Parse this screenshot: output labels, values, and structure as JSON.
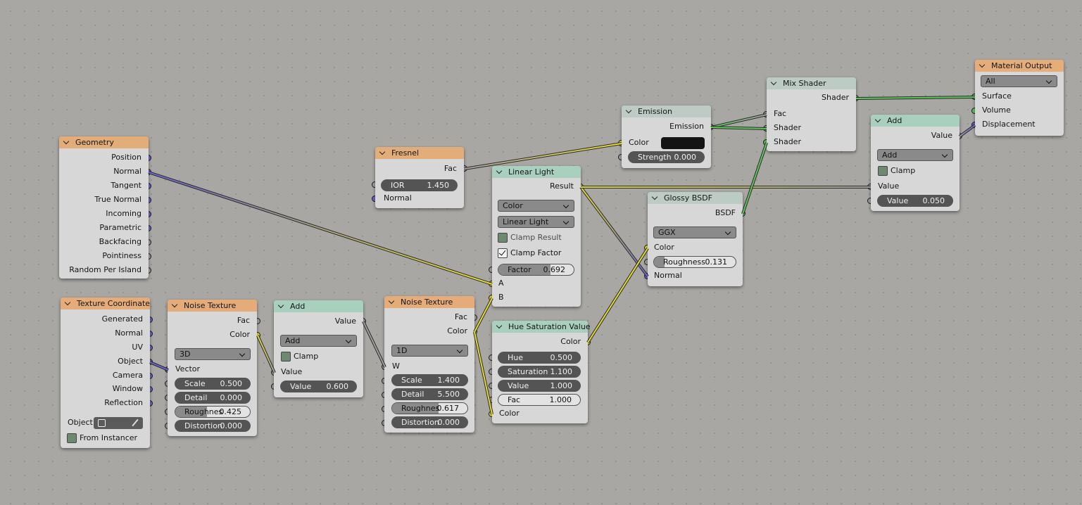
{
  "nodes": {
    "geometry": {
      "title": "Geometry",
      "outputs": [
        "Position",
        "Normal",
        "Tangent",
        "True Normal",
        "Incoming",
        "Parametric",
        "Backfacing",
        "Pointiness",
        "Random Per Island"
      ]
    },
    "texcoord": {
      "title": "Texture Coordinate",
      "outputs": [
        "Generated",
        "Normal",
        "UV",
        "Object",
        "Camera",
        "Window",
        "Reflection"
      ],
      "object_label": "Object:",
      "from_instancer": "From Instancer"
    },
    "noise1": {
      "title": "Noise Texture",
      "out_fac": "Fac",
      "out_color": "Color",
      "dimension": "3D",
      "vector": "Vector",
      "scale_label": "Scale",
      "scale": "0.500",
      "detail_label": "Detail",
      "detail": "0.000",
      "rough_label": "Roughnes",
      "rough": "0.425",
      "rough_fill": 0.425,
      "dist_label": "Distortion",
      "dist": "0.000"
    },
    "add1": {
      "title": "Add",
      "out_value": "Value",
      "operation": "Add",
      "clamp": "Clamp",
      "in_value": "Value",
      "value_label": "Value",
      "value": "0.600"
    },
    "noise2": {
      "title": "Noise Texture",
      "out_fac": "Fac",
      "out_color": "Color",
      "dimension": "1D",
      "w": "W",
      "scale_label": "Scale",
      "scale": "1.400",
      "detail_label": "Detail",
      "detail": "5.500",
      "rough_label": "Roughnes",
      "rough": "0.617",
      "rough_fill": 0.617,
      "dist_label": "Distortion",
      "dist": "0.000"
    },
    "fresnel": {
      "title": "Fresnel",
      "out_fac": "Fac",
      "ior_label": "IOR",
      "ior": "1.450",
      "normal": "Normal"
    },
    "linear": {
      "title": "Linear Light",
      "result": "Result",
      "data_type": "Color",
      "blend": "Linear Light",
      "clamp_result": "Clamp Result",
      "clamp_factor": "Clamp Factor",
      "factor_label": "Factor",
      "factor": "0.692",
      "factor_fill": 0.692,
      "a": "A",
      "b": "B"
    },
    "hsv": {
      "title": "Hue Saturation Value",
      "out_color": "Color",
      "hue_label": "Hue",
      "hue": "0.500",
      "sat_label": "Saturation",
      "sat": "1.100",
      "val_label": "Value",
      "val": "1.000",
      "fac_label": "Fac",
      "fac": "1.000",
      "in_color": "Color"
    },
    "emission": {
      "title": "Emission",
      "out": "Emission",
      "color": "Color",
      "swatch": "#141414",
      "strength_label": "Strength",
      "strength": "0.000"
    },
    "glossy": {
      "title": "Glossy BSDF",
      "out": "BSDF",
      "distribution": "GGX",
      "color": "Color",
      "rough_label": "Roughness",
      "rough": "0.131",
      "rough_fill": 0.131,
      "normal": "Normal"
    },
    "mix": {
      "title": "Mix Shader",
      "out": "Shader",
      "fac": "Fac",
      "shader1": "Shader",
      "shader2": "Shader"
    },
    "add2": {
      "title": "Add",
      "out_value": "Value",
      "operation": "Add",
      "clamp": "Clamp",
      "in_value": "Value",
      "value_label": "Value",
      "value": "0.050"
    },
    "output": {
      "title": "Material Output",
      "target": "All",
      "surface": "Surface",
      "volume": "Volume",
      "displacement": "Displacement"
    }
  },
  "colors": {
    "vector_socket": "#6a66cd",
    "color_socket": "#e4db30",
    "float_socket": "#a0a0a0",
    "shader_socket": "#5dc55b",
    "input_header": "#e3ad79",
    "converter_header": "#a9d0bf",
    "shader_header": "#bccbc3"
  }
}
